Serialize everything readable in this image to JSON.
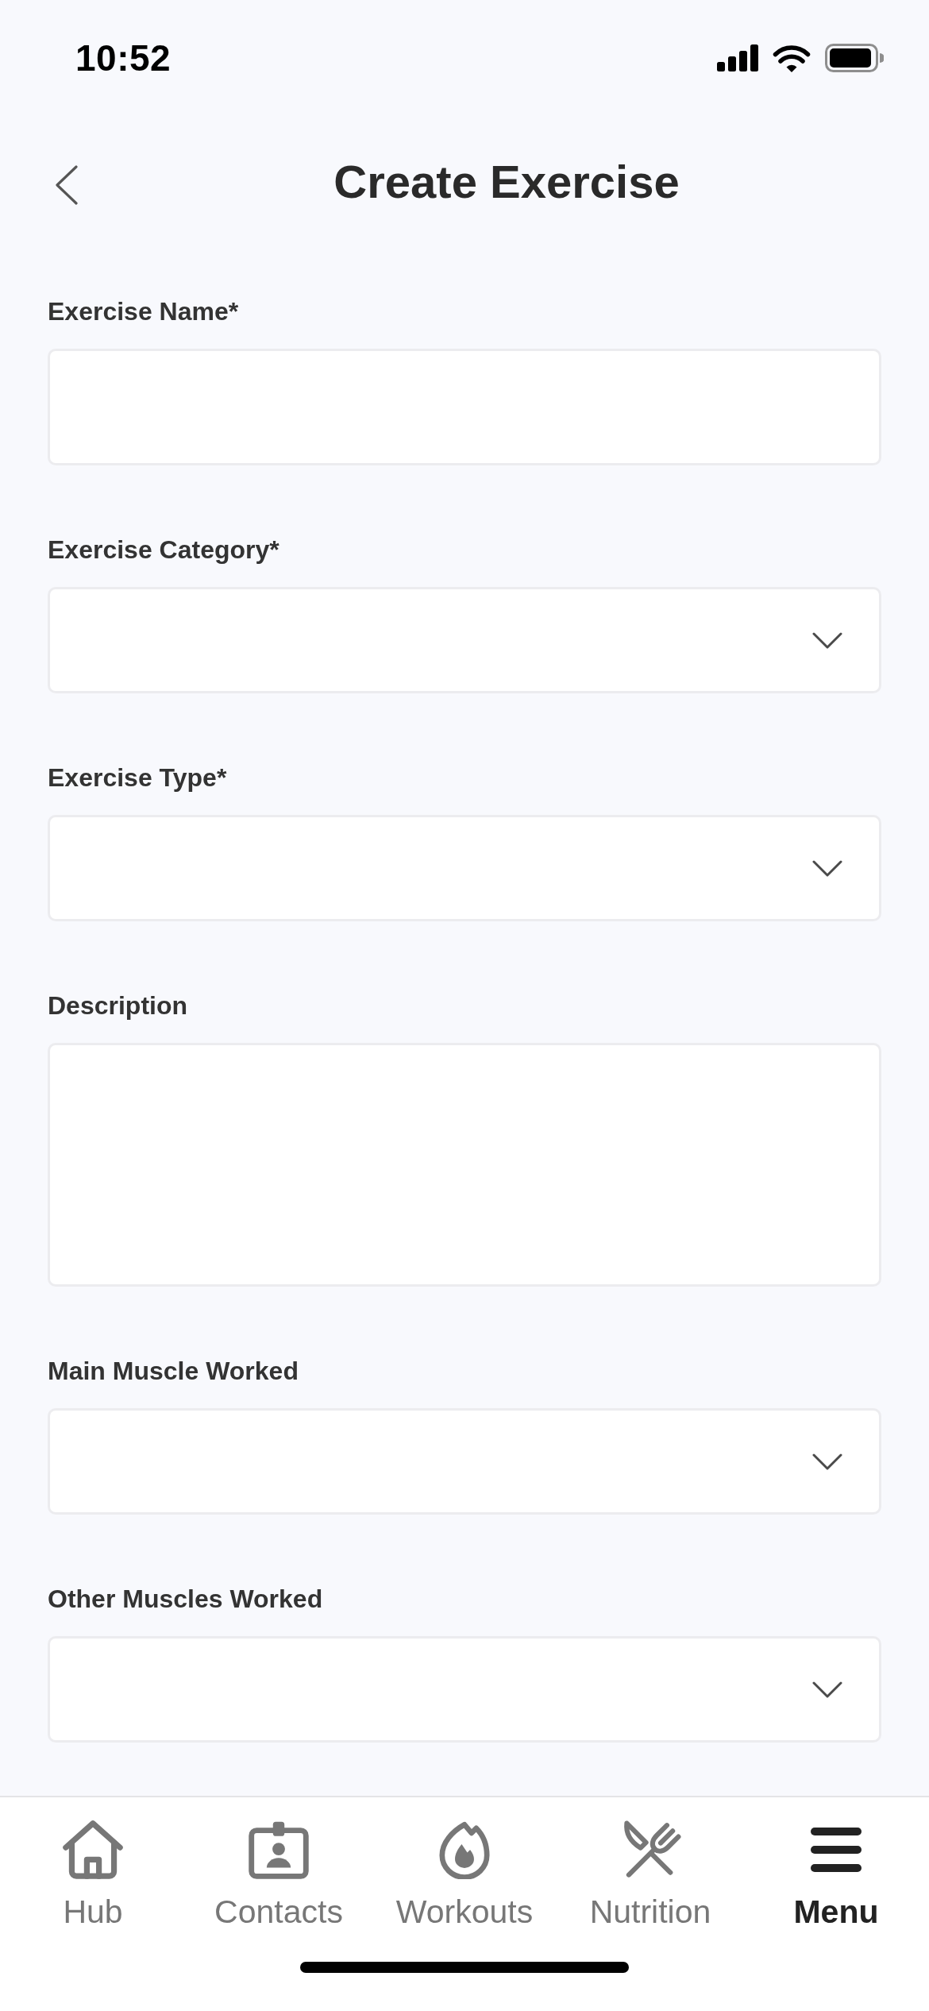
{
  "status_bar": {
    "time": "10:52"
  },
  "header": {
    "title": "Create Exercise"
  },
  "form": {
    "fields": [
      {
        "label": "Exercise Name*",
        "kind": "text"
      },
      {
        "label": "Exercise Category*",
        "kind": "select"
      },
      {
        "label": "Exercise Type*",
        "kind": "select"
      },
      {
        "label": "Description",
        "kind": "textarea"
      },
      {
        "label": "Main Muscle Worked",
        "kind": "select"
      },
      {
        "label": "Other Muscles Worked",
        "kind": "select"
      }
    ]
  },
  "tab_bar": {
    "tabs": [
      {
        "label": "Hub",
        "selected": false
      },
      {
        "label": "Contacts",
        "selected": false
      },
      {
        "label": "Workouts",
        "selected": false
      },
      {
        "label": "Nutrition",
        "selected": false
      },
      {
        "label": "Menu",
        "selected": true
      }
    ]
  }
}
